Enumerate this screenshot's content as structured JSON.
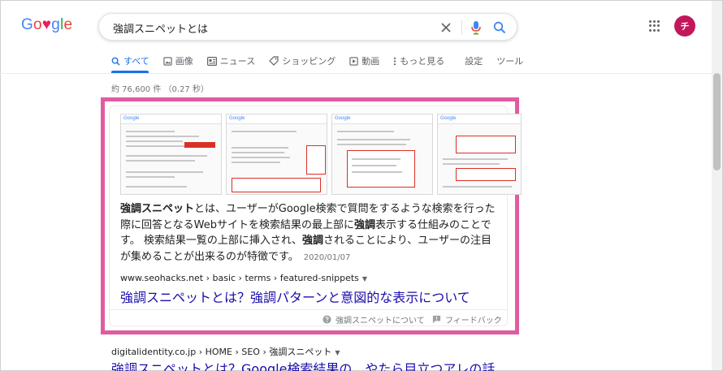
{
  "logo": {
    "text": "Google"
  },
  "search": {
    "query": "強調スニペットとは"
  },
  "account": {
    "initial": "チ"
  },
  "tabs": [
    {
      "label": "すべて",
      "icon": "search-icon",
      "active": true
    },
    {
      "label": "画像",
      "icon": "image-icon"
    },
    {
      "label": "ニュース",
      "icon": "news-icon"
    },
    {
      "label": "ショッピング",
      "icon": "tag-icon"
    },
    {
      "label": "動画",
      "icon": "video-icon"
    },
    {
      "label": "もっと見る",
      "icon": "more-vert-icon"
    },
    {
      "label": "設定"
    },
    {
      "label": "ツール"
    }
  ],
  "stats": "約 76,600 件 （0.27 秒）",
  "featured_snippet": {
    "text_parts": [
      {
        "t": "強調スニペット",
        "bold": true
      },
      {
        "t": "とは、ユーザーがGoogle検索で質問をするような検索を行った際に回答となるWebサイトを検索結果の最上部に",
        "bold": false
      },
      {
        "t": "強調",
        "bold": true
      },
      {
        "t": "表示する仕組みのことです。 検索結果一覧の上部に挿入され、",
        "bold": false
      },
      {
        "t": "強調",
        "bold": true
      },
      {
        "t": "されることにより、ユーザーの注目が集めることが出来るのが特徴です。",
        "bold": false
      }
    ],
    "date": "2020/01/07",
    "cite": "www.seohacks.net › basic › terms › featured-snippets",
    "title": "強調スニペットとは？強調パターンと意図的な表示について",
    "footer": {
      "about": "強調スニペットについて",
      "feedback": "フィードバック"
    }
  },
  "second_result": {
    "cite": "digitalidentity.co.jp › HOME › SEO › 強調スニペット",
    "title": "強調スニペットとは？Google検索結果の　やたら目立つアレの話"
  },
  "colors": {
    "highlight_border": "#e05ca1",
    "link": "#1a0dab",
    "active_tab": "#1a73e8",
    "avatar": "#c2185b"
  }
}
